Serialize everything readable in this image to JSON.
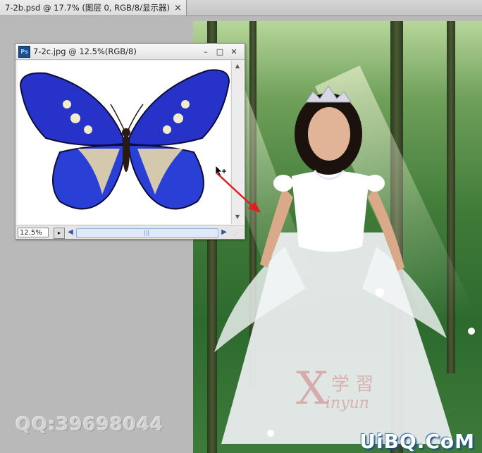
{
  "tab": {
    "title": "7-2b.psd @ 17.7% (图层 0, RGB/8/显示器)",
    "close": "×"
  },
  "float_window": {
    "app_icon": "Ps",
    "title": "7-2c.jpg @ 12.5%(RGB/8)",
    "minimize": "–",
    "maximize": "□",
    "close": "✕",
    "zoom": "12.5%"
  },
  "watermarks": {
    "qq": "QQ:39698044",
    "site": "UiBQ.CoM",
    "letter": "X",
    "cn": "学 習",
    "sub": "inyun"
  },
  "icons": [
    "ps-icon",
    "minimize-icon",
    "maximize-icon",
    "close-icon",
    "move-cursor-icon",
    "red-arrow-icon",
    "scroll-left-icon",
    "scroll-right-icon"
  ],
  "colors": {
    "accent_blue": "#2a5aa8",
    "arrow_red": "#e02020",
    "butterfly_blue": "#2733c8"
  }
}
